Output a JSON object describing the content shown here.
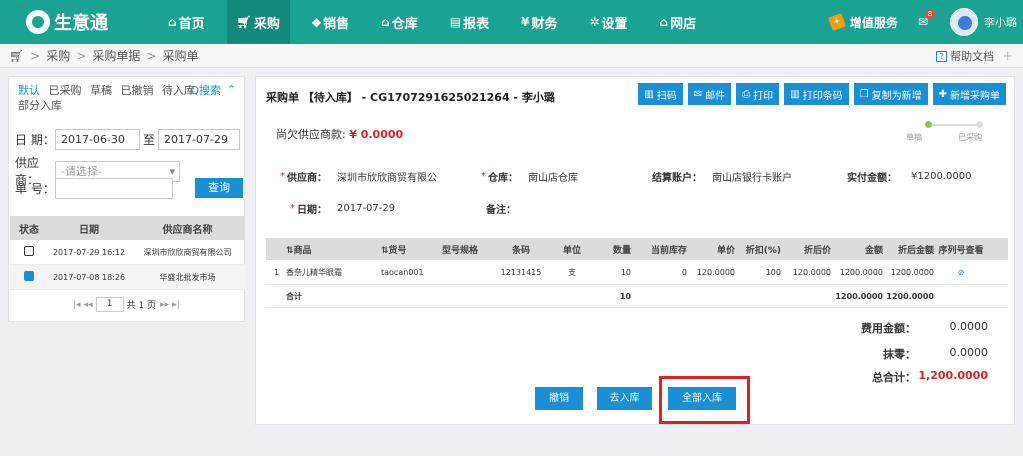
{
  "topbar": {
    "logo_text": "生意通",
    "nav": [
      {
        "label": "首页",
        "icon": "home-icon"
      },
      {
        "label": "采购",
        "icon": "cart-icon"
      },
      {
        "label": "销售",
        "icon": "tag-icon"
      },
      {
        "label": "仓库",
        "icon": "warehouse-icon"
      },
      {
        "label": "报表",
        "icon": "report-icon"
      },
      {
        "label": "财务",
        "icon": "yen-icon"
      },
      {
        "label": "设置",
        "icon": "gear-icon"
      },
      {
        "label": "网店",
        "icon": "store-icon"
      }
    ],
    "active_nav": "采购",
    "value_added": "增值服务",
    "mail_badge": "8",
    "user_name": "李小璐"
  },
  "breadcrumb": {
    "items": [
      "采购",
      "采购单据",
      "采购单"
    ],
    "help": "帮助文档"
  },
  "left": {
    "tabs": [
      "默认",
      "已采购",
      "草稿",
      "已撤销",
      "待入库",
      "部分入库"
    ],
    "search": "Q搜索",
    "filters": {
      "date_label": "日 期：",
      "date_from": "2017-06-30",
      "date_to_label": "至",
      "date_to": "2017-07-29",
      "supplier_label": "供应商：",
      "supplier_placeholder": "-请选择-",
      "number_label": "单 号：",
      "query_button": "查询"
    },
    "table": {
      "headers": [
        "状态",
        "日期",
        "供应商名称"
      ],
      "rows": [
        {
          "date": "2017-07-29 16:12",
          "supplier": "深圳市欣欣商贸有限公司"
        },
        {
          "date": "2017-07-08 18:26",
          "supplier": "华盛北批发市场"
        }
      ]
    },
    "pager": {
      "page": "1",
      "total": "共 1 页"
    }
  },
  "main": {
    "title": "采购单 【待入库】 - CG1707291625021264 - 李小璐",
    "actions": [
      "扫码",
      "邮件",
      "打印",
      "打印条码",
      "复制为新增",
      "新增采购单"
    ],
    "owe_label": "尚欠供应商款:",
    "owe_amount": "¥ 0.0000",
    "steps": [
      "草稿",
      "已采购"
    ],
    "fields": {
      "supplier_label": "供应商：",
      "supplier_value": "深圳市欣欣商贸有限公司",
      "warehouse_label": "仓库：",
      "warehouse_value": "南山店仓库",
      "account_label": "结算账户：",
      "account_value": "南山店银行卡账户",
      "paid_label": "实付金额：",
      "paid_value": "¥1200.0000",
      "date_label": "日期：",
      "date_value": "2017-07-29",
      "remark_label": "备注："
    },
    "table": {
      "headers": [
        "",
        "⇅商品",
        "⇅货号",
        "型号规格",
        "条码",
        "单位",
        "数量",
        "当前库存",
        "单价",
        "折扣(%)",
        "折后价",
        "金额",
        "折后金额",
        "序列号查看"
      ],
      "rows": [
        [
          "1",
          "香奈儿精华眼霜",
          "taocan001",
          "",
          "12131415",
          "支",
          "10",
          "0",
          "120.0000",
          "100",
          "120.0000",
          "1200.0000",
          "1200.0000",
          ""
        ]
      ],
      "total": {
        "label": "合计",
        "qty": "10",
        "amount": "1200.0000",
        "discounted": "1200.0000"
      }
    },
    "summary": {
      "fee_label": "费用金额：",
      "fee_value": "0.0000",
      "rounding_label": "抹零：",
      "rounding_value": "0.0000",
      "total_label": "总合计：",
      "total_value": "1,200.0000"
    },
    "buttons": [
      "撤销",
      "去入库",
      "全部入库"
    ]
  }
}
